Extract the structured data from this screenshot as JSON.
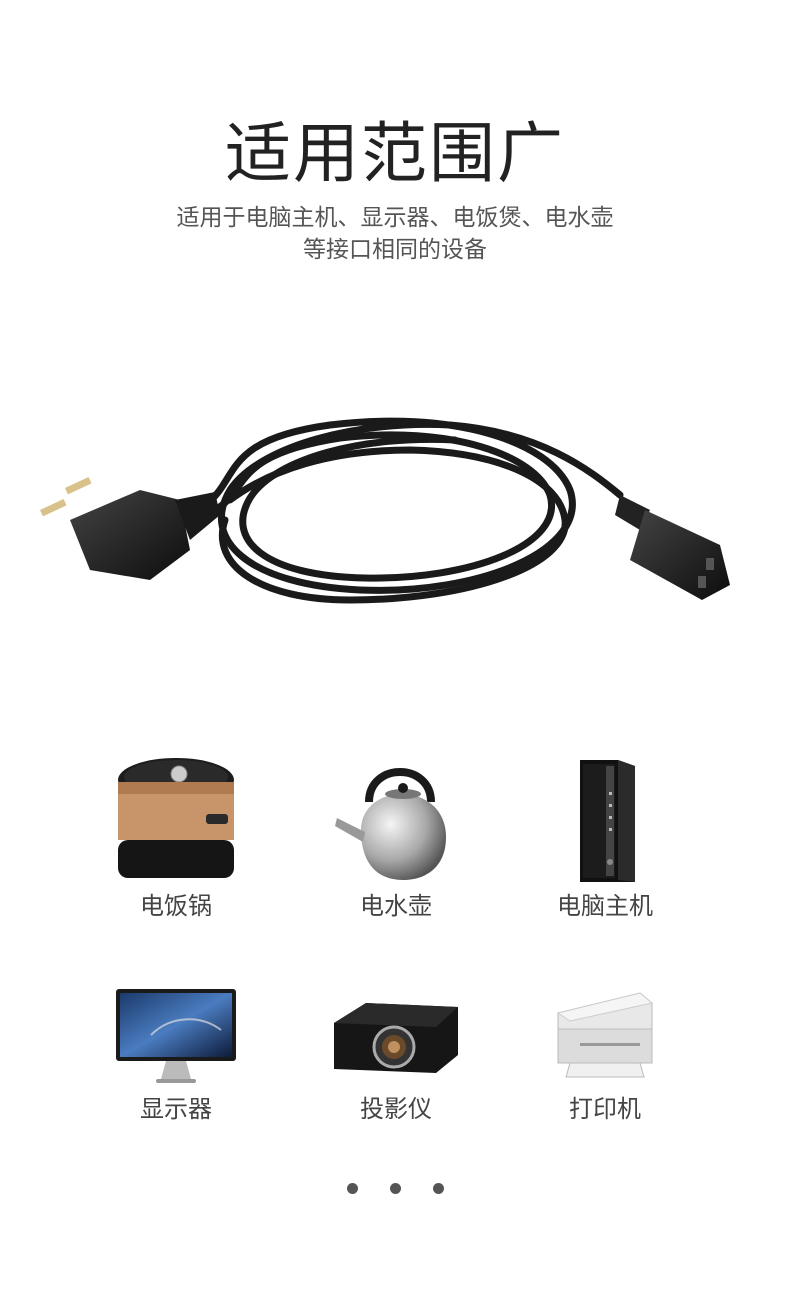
{
  "title": "适用范围广",
  "subtitle": {
    "line1": "适用于电脑主机、显示器、电饭煲、电水壶",
    "line2": "等接口相同的设备"
  },
  "devices": [
    {
      "label": "电饭锅",
      "icon": "rice-cooker-icon"
    },
    {
      "label": "电水壶",
      "icon": "kettle-icon"
    },
    {
      "label": "电脑主机",
      "icon": "computer-tower-icon"
    },
    {
      "label": "显示器",
      "icon": "monitor-icon"
    },
    {
      "label": "投影仪",
      "icon": "projector-icon"
    },
    {
      "label": "打印机",
      "icon": "printer-icon"
    }
  ],
  "pagination": {
    "count": 3
  },
  "colors": {
    "background": "#ffffff",
    "text": "#333333",
    "cable": "#1a1a1a",
    "copper": "#c8956b"
  }
}
